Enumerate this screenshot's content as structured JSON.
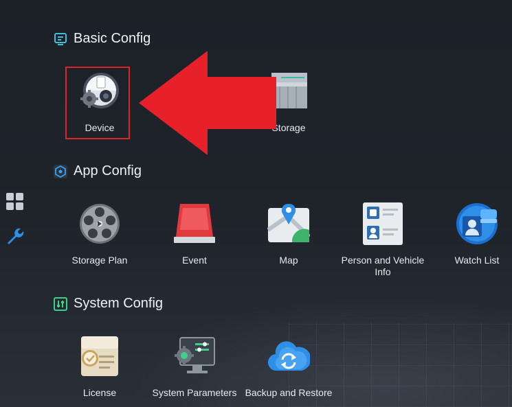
{
  "sections": {
    "basic": {
      "title": "Basic Config",
      "items": [
        {
          "label": "Device",
          "icon": "device-icon"
        },
        {
          "label": "Storage",
          "icon": "storage-icon"
        }
      ]
    },
    "app": {
      "title": "App Config",
      "items": [
        {
          "label": "Storage Plan",
          "icon": "film-reel-icon"
        },
        {
          "label": "Event",
          "icon": "alarm-light-icon"
        },
        {
          "label": "Map",
          "icon": "map-icon"
        },
        {
          "label": "Person and Vehicle Info",
          "icon": "id-card-icon"
        },
        {
          "label": "Watch List",
          "icon": "watch-list-icon"
        }
      ]
    },
    "system": {
      "title": "System Config",
      "items": [
        {
          "label": "License",
          "icon": "license-icon"
        },
        {
          "label": "System Parameters",
          "icon": "system-parameters-icon"
        },
        {
          "label": "Backup and Restore",
          "icon": "cloud-sync-icon"
        }
      ]
    }
  },
  "colors": {
    "accent_blue": "#2f8fe6",
    "annotation_red": "#e8202a"
  }
}
